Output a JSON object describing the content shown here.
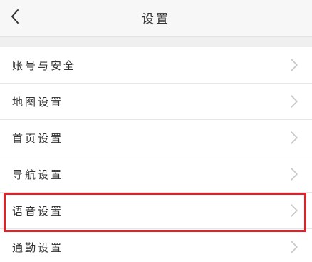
{
  "header": {
    "title": "设置",
    "back_icon": "chevron-left-icon"
  },
  "settings": {
    "items": [
      {
        "label": "账号与安全",
        "icon": "chevron-right-icon"
      },
      {
        "label": "地图设置",
        "icon": "chevron-right-icon"
      },
      {
        "label": "首页设置",
        "icon": "chevron-right-icon"
      },
      {
        "label": "导航设置",
        "icon": "chevron-right-icon"
      },
      {
        "label": "语音设置",
        "icon": "chevron-right-icon",
        "highlighted": true
      },
      {
        "label": "通勤设置",
        "icon": "chevron-right-icon"
      }
    ]
  },
  "colors": {
    "highlight": "#d9242b",
    "background": "#f4f4f4",
    "row_background": "#ffffff",
    "text": "#333333",
    "chevron": "#c8c8c8"
  }
}
